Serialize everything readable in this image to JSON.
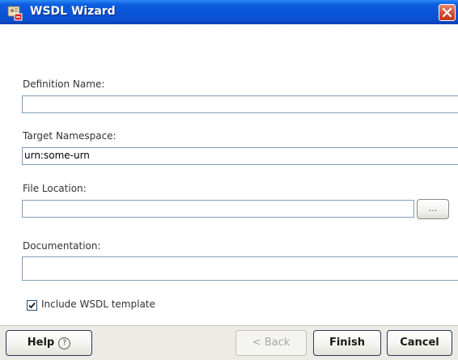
{
  "window": {
    "title": "WSDL Wizard",
    "title_icon": "wsdl-wizard-app-icon",
    "close_icon": "close-icon"
  },
  "form": {
    "definition_name": {
      "label": "Definition Name:",
      "value": ""
    },
    "target_namespace": {
      "label": "Target Namespace:",
      "value": "urn:some-urn"
    },
    "file_location": {
      "label": "File Location:",
      "value": "",
      "browse_label": "..."
    },
    "documentation": {
      "label": "Documentation:",
      "value": ""
    },
    "include_template": {
      "label": "Include WSDL template",
      "checked": true
    }
  },
  "buttons": {
    "help": "Help",
    "help_icon_glyph": "?",
    "back": "< Back",
    "finish": "Finish",
    "cancel": "Cancel"
  },
  "colors": {
    "titlebar": "#0a54d6",
    "close_button": "#d3482a",
    "field_border": "#7f9db9"
  }
}
